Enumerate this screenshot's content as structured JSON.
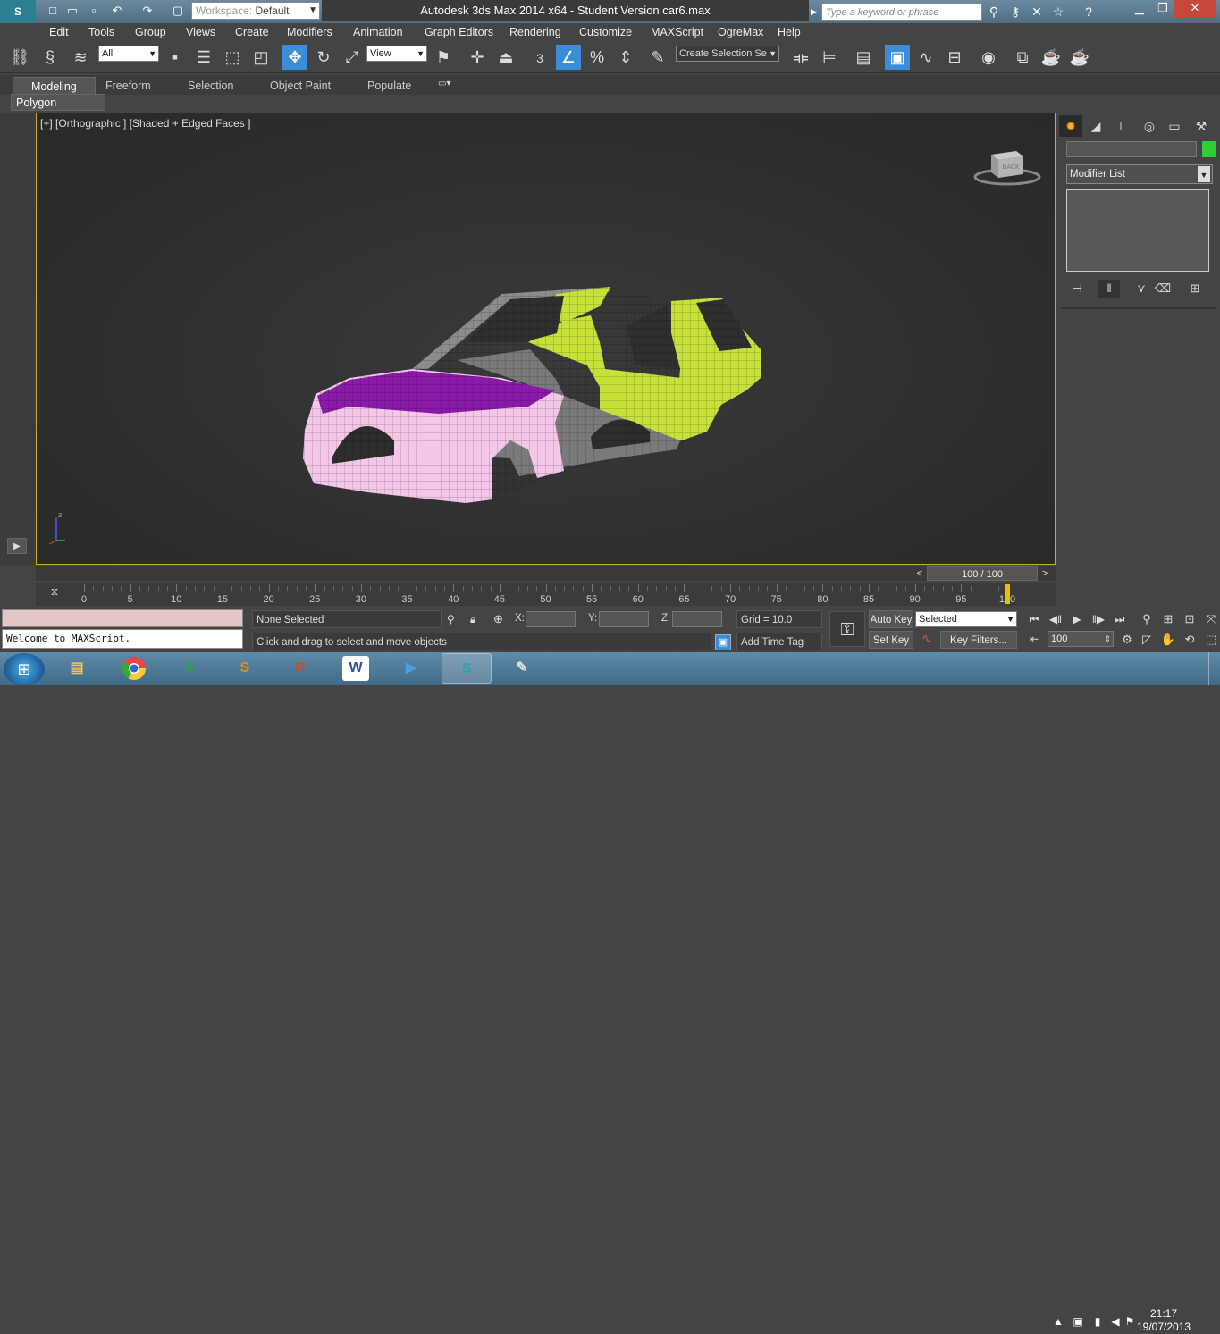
{
  "titlebar": {
    "app_icon": "3ds-max-logo-icon",
    "workspace_prefix": "Workspace:",
    "workspace_value": "Default",
    "window_title": "Autodesk 3ds Max  2014 x64   - Student Version    car6.max",
    "search_placeholder": "Type a keyword or phrase"
  },
  "menu": {
    "items": [
      "Edit",
      "Tools",
      "Group",
      "Views",
      "Create",
      "Modifiers",
      "Animation",
      "Graph Editors",
      "Rendering",
      "Customize",
      "MAXScript",
      "OgreMax",
      "Help"
    ]
  },
  "toolbar": {
    "filter_value": "All",
    "ref_coord_value": "View",
    "angle_snap_label": "3",
    "selection_set_placeholder": "Create Selection Se"
  },
  "ribbon": {
    "tabs": [
      "Modeling",
      "Freeform",
      "Selection",
      "Object Paint",
      "Populate"
    ],
    "active_tab": "Modeling",
    "panel_label": "Polygon Modeling"
  },
  "viewport": {
    "label": "[+] [Orthographic ] [Shaded + Edged Faces ]",
    "viewcube_label": "BACK",
    "axis_label": "z",
    "colors": {
      "hood": "#8a1aa8",
      "front_body": "#f4c6e8",
      "middle_door": "#7a7a7a",
      "rear_body": "#c8e03a",
      "roof_grey": "#8c8c8c"
    }
  },
  "command_panel": {
    "modifier_list_label": "Modifier List",
    "object_color": "#33cc33"
  },
  "timeline": {
    "frame_display": "100 / 100",
    "tick_labels": [
      "0",
      "5",
      "10",
      "15",
      "20",
      "25",
      "30",
      "35",
      "40",
      "45",
      "50",
      "55",
      "60",
      "65",
      "70",
      "75",
      "80",
      "85",
      "90",
      "95",
      "100"
    ],
    "current_frame": 100
  },
  "status": {
    "script_output": "Welcome to MAXScript.",
    "selection_status": "None Selected",
    "prompt": "Click and drag to select and move objects",
    "x_label": "X:",
    "y_label": "Y:",
    "z_label": "Z:",
    "grid": "Grid = 10.0",
    "add_time_tag": "Add Time Tag",
    "auto_key": "Auto Key",
    "set_key": "Set Key",
    "selected_value": "Selected",
    "key_filters": "Key Filters...",
    "frame_field": "100"
  },
  "taskbar": {
    "apps": [
      "explorer",
      "chrome",
      "excel",
      "slides",
      "powerpoint",
      "word",
      "media-player",
      "3ds-max",
      "paint"
    ],
    "time": "21:17",
    "date": "19/07/2013"
  }
}
